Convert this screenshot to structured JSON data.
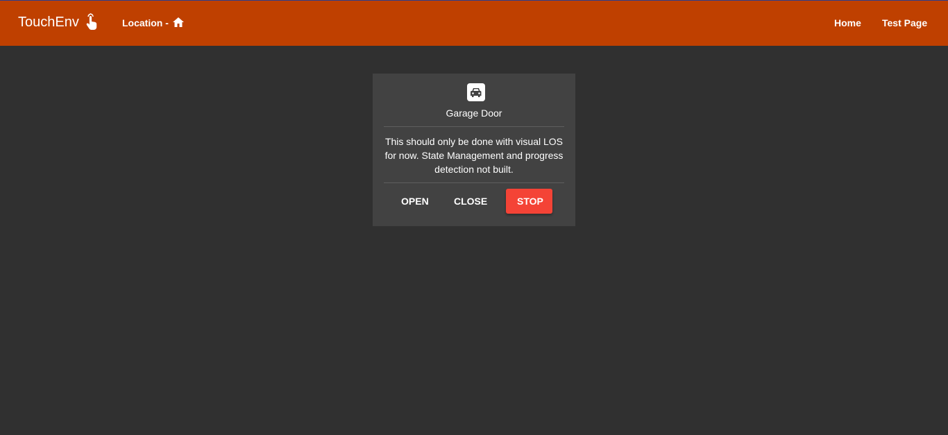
{
  "header": {
    "brand": "TouchEnv",
    "brand_icon": "touch-hand-icon",
    "location_label": "Location -",
    "location_icon": "home-icon",
    "nav": [
      {
        "label": "Home"
      },
      {
        "label": "Test Page"
      }
    ],
    "bar_color": "#bf4000"
  },
  "card": {
    "icon": "garage-car-icon",
    "title": "Garage Door",
    "message": "This should only be done with visual LOS for now. State Management and progress detection not built.",
    "buttons": {
      "open": "OPEN",
      "close": "CLOSE",
      "stop": "STOP"
    },
    "stop_color": "#f44336"
  }
}
